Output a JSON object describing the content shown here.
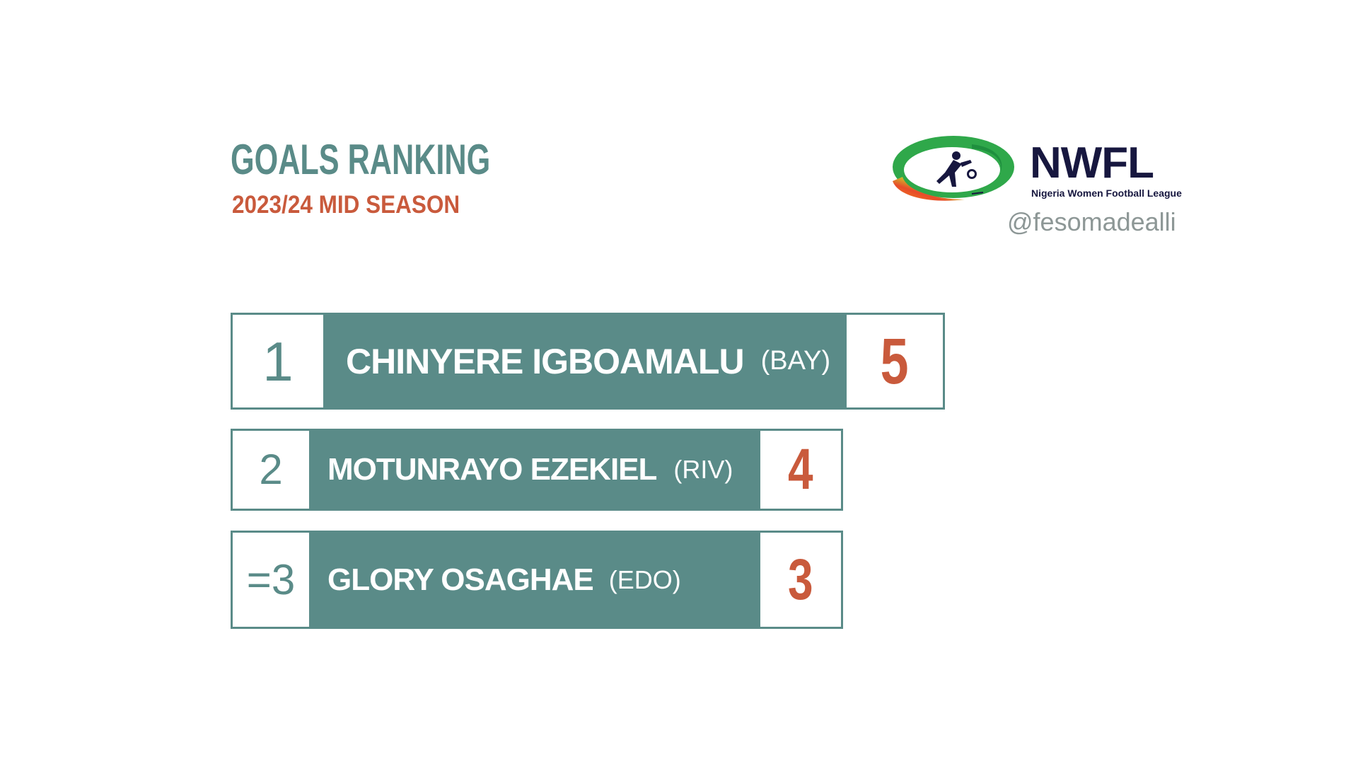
{
  "header": {
    "title": "GOALS RANKING",
    "subtitle": "2023/24 MID SEASON"
  },
  "branding": {
    "logo_wordmark": "NWFL",
    "logo_tagline": "Nigeria Women Football League",
    "handle": "@fesomadealli"
  },
  "rankings": [
    {
      "rank": "1",
      "name": "CHINYERE IGBOAMALU",
      "team": "(BAY)",
      "goals": "5"
    },
    {
      "rank": "2",
      "name": "MOTUNRAYO EZEKIEL",
      "team": "(RIV)",
      "goals": "4"
    },
    {
      "rank": "=3",
      "name": "GLORY OSAGHAE",
      "team": "(EDO)",
      "goals": "3"
    }
  ],
  "colors": {
    "teal": "#5a8b88",
    "accent": "#c95a3c",
    "handle_gray": "#8d9796",
    "logo_navy": "#17173f"
  }
}
